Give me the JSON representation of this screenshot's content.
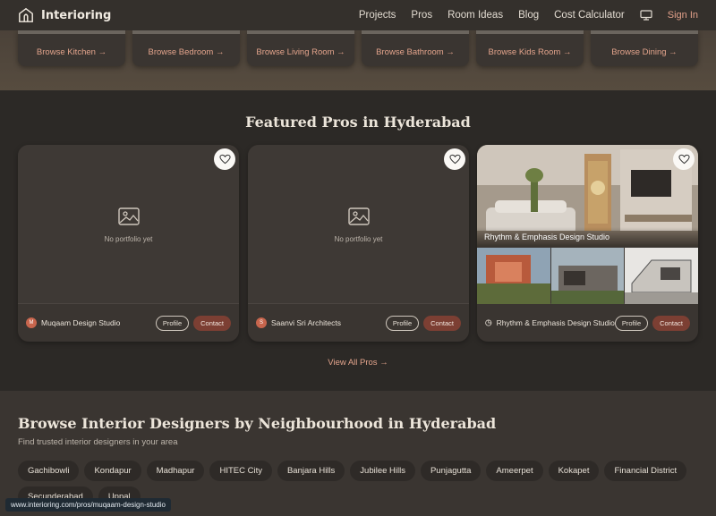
{
  "header": {
    "brand": "Interioring",
    "nav": [
      "Projects",
      "Pros",
      "Room Ideas",
      "Blog",
      "Cost Calculator"
    ],
    "sign_in": "Sign In",
    "icons": {
      "logo": "home-logo-icon",
      "screen": "monitor-icon"
    }
  },
  "browse": [
    "Browse Kitchen →",
    "Browse Bedroom →",
    "Browse Living Room →",
    "Browse Bathroom →",
    "Browse Kids Room →",
    "Browse Dining →"
  ],
  "featured": {
    "title": "Featured Pros in Hyderabad",
    "cards": [
      {
        "name": "Muqaam Design Studio",
        "avatar": "M",
        "empty": "No portfolio yet",
        "profile": "Profile",
        "contact": "Contact"
      },
      {
        "name": "Saanvi Sri Architects",
        "avatar": "S",
        "empty": "No portfolio yet",
        "profile": "Profile",
        "contact": "Contact"
      },
      {
        "name": "Rhythm & Emphasis Design Studio",
        "caption": "Rhythm & Emphasis Design Studio",
        "profile": "Profile",
        "contact": "Contact"
      }
    ],
    "view_all": "View All Pros →"
  },
  "neighbourhoods": {
    "title": "Browse Interior Designers by Neighbourhood in Hyderabad",
    "subtitle": "Find trusted interior designers in your area",
    "chips": [
      "Gachibowli",
      "Kondapur",
      "Madhapur",
      "HITEC City",
      "Banjara Hills",
      "Jubilee Hills",
      "Punjagutta",
      "Ameerpet",
      "Kokapet",
      "Financial District",
      "Secunderabad",
      "Uppal"
    ]
  },
  "status_url": "www.interioring.com/pros/muqaam-design-studio",
  "colors": {
    "accent": "#e3a48c",
    "contact_bg": "#7c3f33",
    "page_bg": "#2c2926",
    "card_bg": "#3a3531"
  }
}
